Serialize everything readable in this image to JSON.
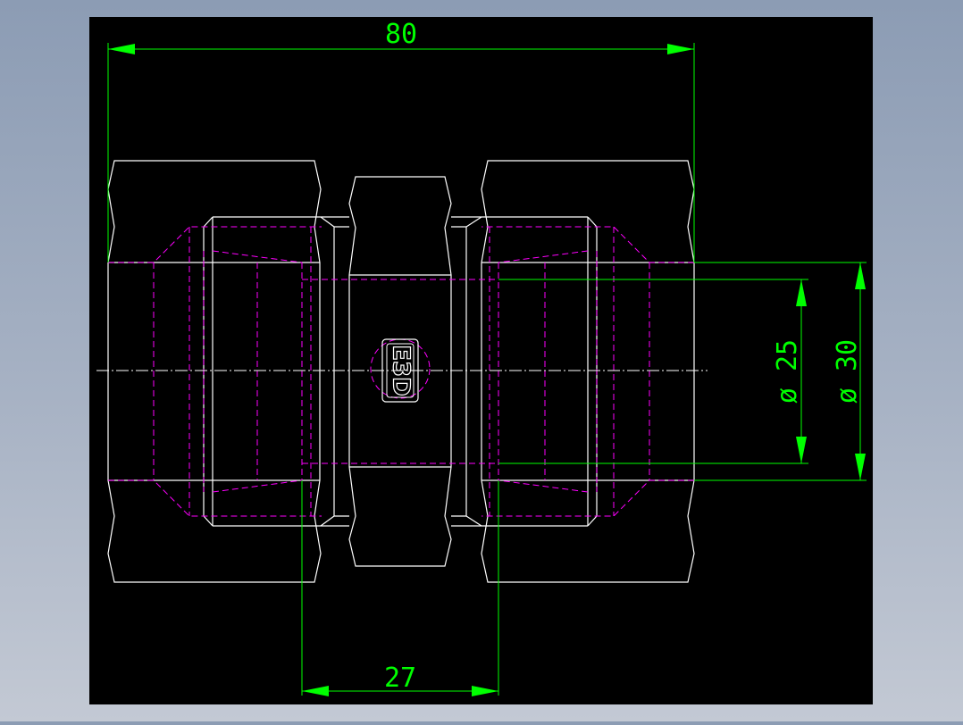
{
  "colors": {
    "background": "#000000",
    "outline": "#ffffff",
    "hidden": "#ff00ff",
    "dimension": "#00ff00",
    "centerline": "#ffffff"
  },
  "dimensions": {
    "overall_length": "80",
    "inner_length": "27",
    "diameter_inner": "ø 25",
    "diameter_outer": "ø 30"
  },
  "logo": {
    "text": "E3D"
  }
}
